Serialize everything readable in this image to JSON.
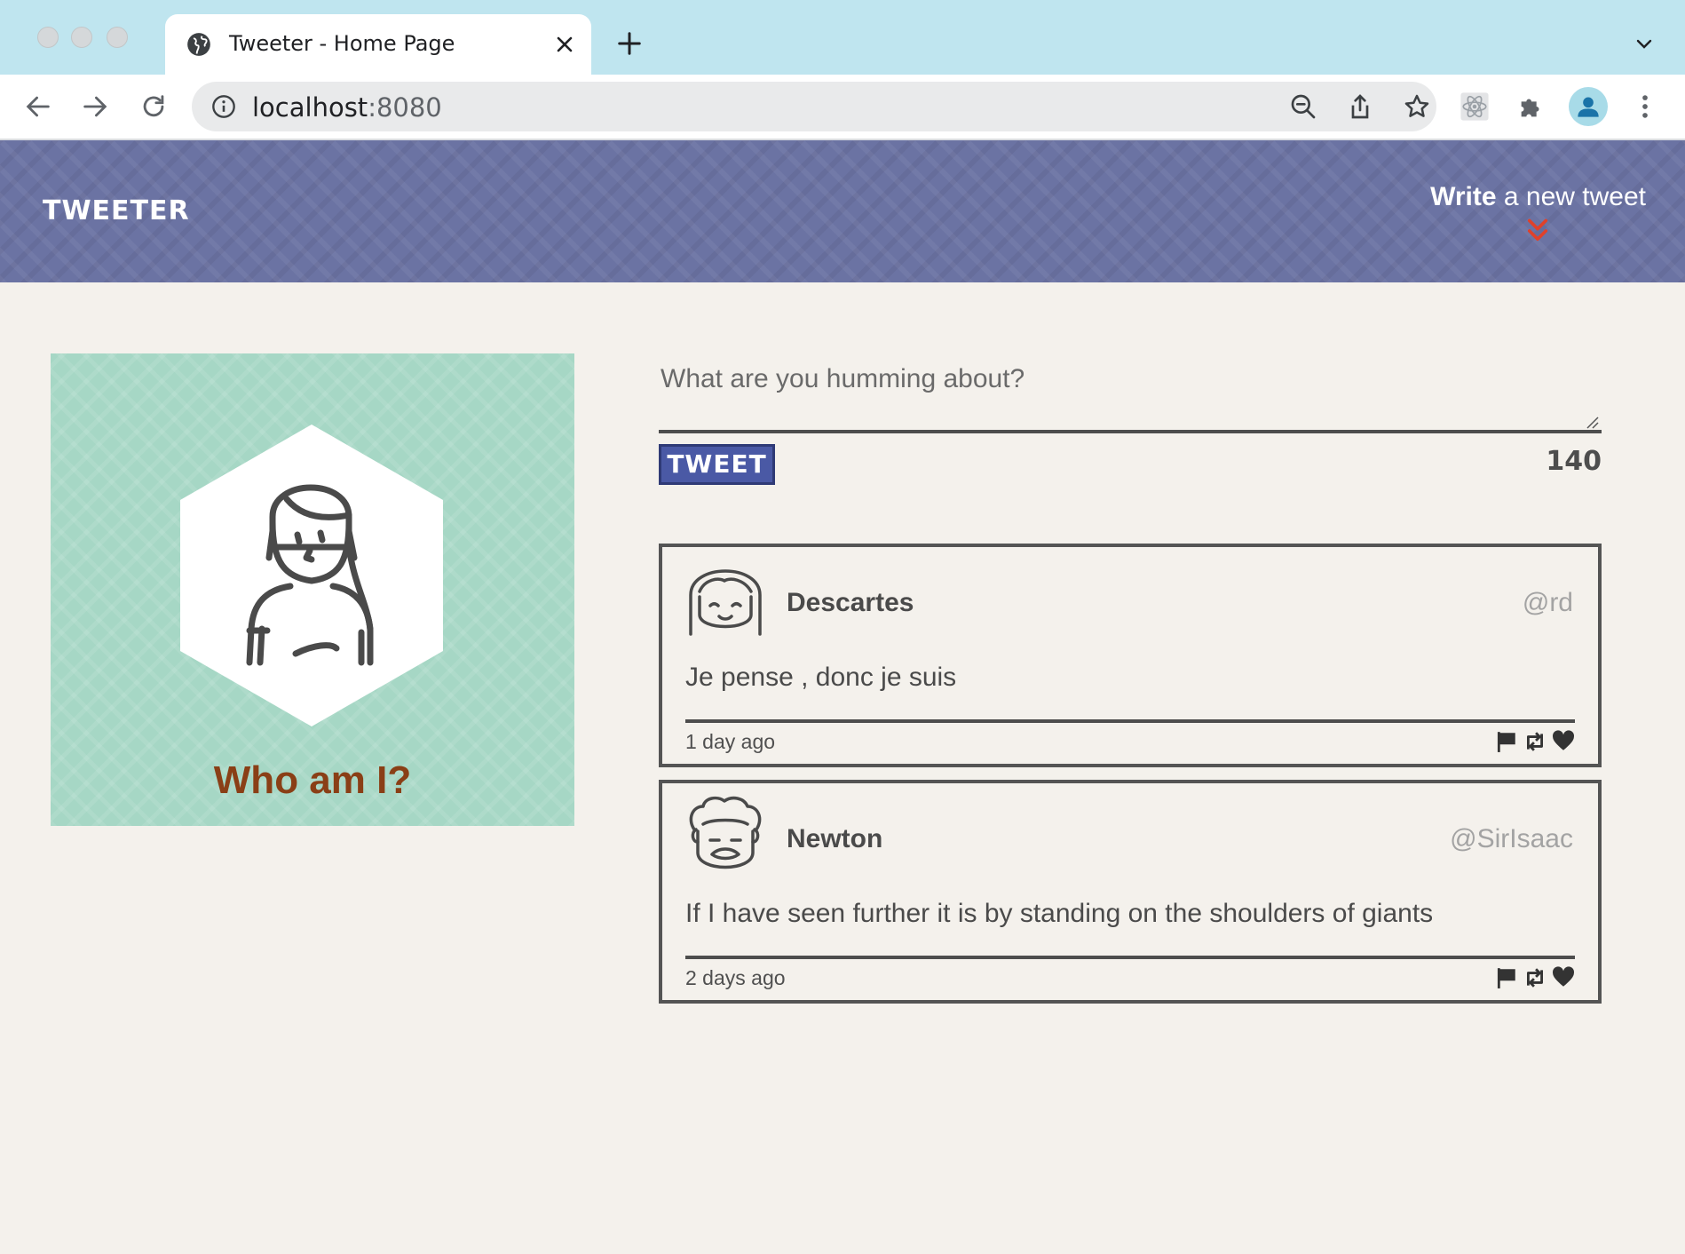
{
  "browser": {
    "tab_title": "Tweeter - Home Page",
    "url_host": "localhost",
    "url_port": ":8080"
  },
  "header": {
    "brand": "TWEETER",
    "compose_bold": "Write",
    "compose_rest": " a new tweet"
  },
  "profile": {
    "name": "Who am I?"
  },
  "composer": {
    "placeholder": "What are you humming about?",
    "button_label": "TWEET",
    "counter": "140"
  },
  "tweets": [
    {
      "name": "Descartes",
      "handle": "@rd",
      "content": "Je pense , donc je suis",
      "time": "1 day ago"
    },
    {
      "name": "Newton",
      "handle": "@SirIsaac",
      "content": "If I have seen further it is by standing on the shoulders of giants",
      "time": "2 days ago"
    }
  ],
  "icons": {
    "tab": [
      "globe-icon",
      "close-icon",
      "plus-icon",
      "chevron-down-icon"
    ],
    "toolbar": [
      "back-arrow-icon",
      "forward-arrow-icon",
      "reload-icon",
      "info-icon",
      "zoom-out-icon",
      "share-icon",
      "star-icon",
      "react-devtools-icon",
      "puzzle-icon",
      "profile-icon",
      "kebab-menu-icon"
    ],
    "tweet_actions": [
      "flag-icon",
      "retweet-icon",
      "heart-icon"
    ]
  },
  "colors": {
    "header_bg": "#6b73a3",
    "page_bg": "#f4f1ec",
    "profile_bg": "#a6d7c5",
    "profile_name": "#8a3f16",
    "tweet_button": "#4a59a5",
    "accent_arrows": "#e0412a",
    "tabstrip_bg": "#bfe5ef"
  }
}
